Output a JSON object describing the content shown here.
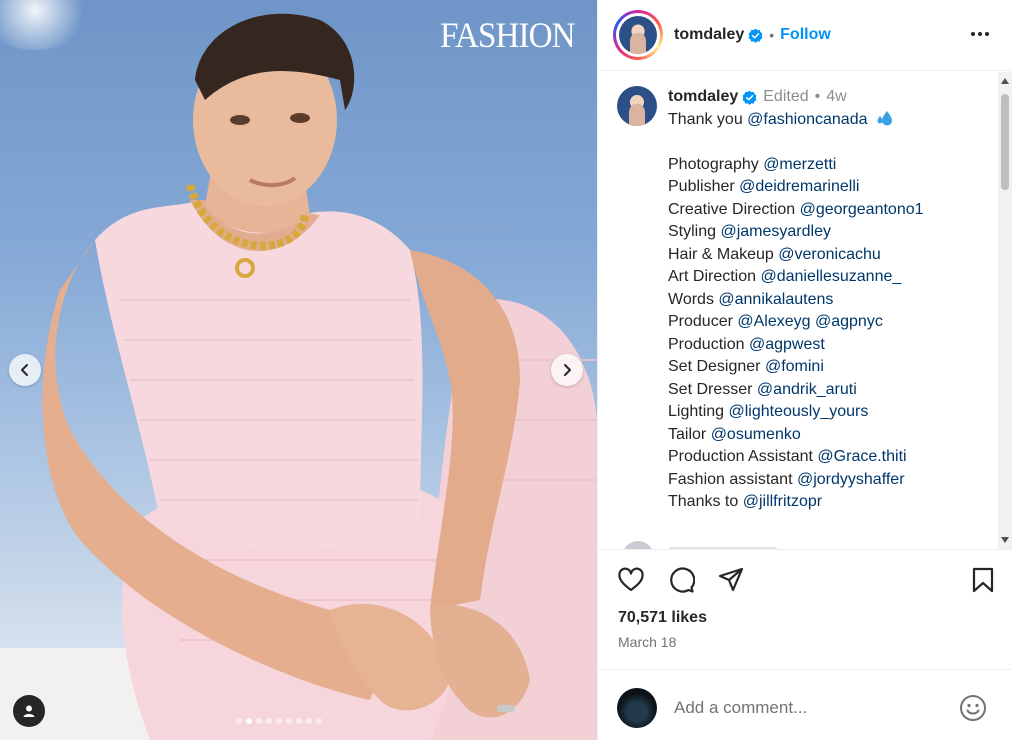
{
  "post": {
    "magazine_logo": "FASHION",
    "carousel_dots": 9,
    "carousel_active_index": 1
  },
  "header": {
    "username": "tomdaley",
    "separator": "•",
    "follow_label": "Follow"
  },
  "caption": {
    "username": "tomdaley",
    "edited_label": "Edited",
    "dot": "•",
    "age": "4w",
    "intro_text": "Thank you",
    "intro_mention": "@fashioncanada",
    "credits": [
      {
        "role": "Photography",
        "mention": "@merzetti"
      },
      {
        "role": "Publisher",
        "mention": "@deidremarinelli"
      },
      {
        "role": "Creative Direction",
        "mention": "@georgeantono1"
      },
      {
        "role": "Styling",
        "mention": "@jamesyardley"
      },
      {
        "role": "Hair & Makeup",
        "mention": "@veronicachu"
      },
      {
        "role": "Art Direction",
        "mention": "@daniellesuzanne_"
      },
      {
        "role": "Words",
        "mention": "@annikalautens"
      },
      {
        "role": "Producer",
        "mention": "@Alexeyg @agpnyc"
      },
      {
        "role": "Production",
        "mention": "@agpwest"
      },
      {
        "role": "Set Designer",
        "mention": "@fomini"
      },
      {
        "role": "Set Dresser",
        "mention": "@andrik_aruti"
      },
      {
        "role": "Lighting",
        "mention": "@lighteously_yours"
      },
      {
        "role": "Tailor",
        "mention": "@osumenko"
      },
      {
        "role": "Production Assistant",
        "mention": "@Grace.thiti"
      },
      {
        "role": "Fashion assistant",
        "mention": "@jordyyshaffer"
      },
      {
        "role": "Thanks to",
        "mention": "@jillfritzopr"
      }
    ]
  },
  "actions": {
    "likes": "70,571 likes",
    "date": "March 18"
  },
  "comment": {
    "placeholder": "Add a comment..."
  },
  "colors": {
    "link": "#00376b",
    "follow": "#0095f6",
    "verified": "#0095f6",
    "muted": "#737373"
  },
  "icons": [
    "chevron-left-icon",
    "chevron-right-icon",
    "user-tag-icon",
    "verified-badge-icon",
    "more-icon",
    "water-drops-emoji",
    "heart-icon",
    "comment-icon",
    "share-icon",
    "bookmark-icon",
    "emoji-icon"
  ]
}
